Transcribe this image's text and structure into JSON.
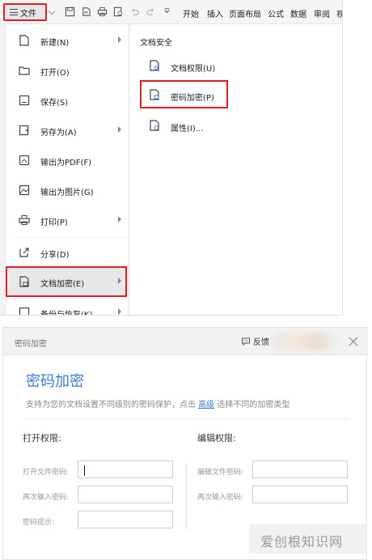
{
  "toolbar": {
    "file_label": "文件",
    "ribbon_tabs": [
      "开始",
      "插入",
      "页面布局",
      "公式",
      "数据",
      "审阅",
      "视"
    ]
  },
  "left_menu": {
    "items": [
      {
        "label": "新建(N)",
        "icon": "new-doc-icon",
        "submenu": true
      },
      {
        "label": "打开(O)",
        "icon": "folder-icon",
        "submenu": false
      },
      {
        "label": "保存(S)",
        "icon": "save-icon",
        "submenu": false
      },
      {
        "label": "另存为(A)",
        "icon": "save-as-icon",
        "submenu": true
      },
      {
        "label": "输出为PDF(F)",
        "icon": "pdf-icon",
        "submenu": false
      },
      {
        "label": "输出为图片(G)",
        "icon": "image-icon",
        "submenu": false
      },
      {
        "label": "打印(P)",
        "icon": "print-icon",
        "submenu": true
      },
      {
        "label": "分享(D)",
        "icon": "share-icon",
        "submenu": false
      },
      {
        "label": "文档加密(E)",
        "icon": "encrypt-doc-icon",
        "submenu": true
      },
      {
        "label": "备份与恢复(K)",
        "icon": "backup-icon",
        "submenu": true
      }
    ]
  },
  "right_pane": {
    "title": "文档安全",
    "items": [
      {
        "label": "文档权限(U)",
        "icon": "doc-permission-icon"
      },
      {
        "label": "密码加密(P)",
        "icon": "doc-lock-icon"
      },
      {
        "label": "属性(I)...",
        "icon": "doc-properties-icon"
      }
    ]
  },
  "dialog": {
    "title": "密码加密",
    "feedback_label": "反馈",
    "heading": "密码加密",
    "desc_prefix": "支持为您的文档设置不同级别的密码保护，点击",
    "desc_link": "高级",
    "desc_suffix": "选择不同的加密类型",
    "open_section": {
      "title": "打开权限:",
      "fields": [
        {
          "label": "打开文件密码:",
          "value": ""
        },
        {
          "label": "再次输入密码:",
          "value": ""
        },
        {
          "label": "密码提示:",
          "value": ""
        }
      ]
    },
    "edit_section": {
      "title": "编辑权限:",
      "fields": [
        {
          "label": "编辑文件密码:",
          "value": ""
        },
        {
          "label": "再次输入密码:",
          "value": ""
        }
      ]
    }
  },
  "watermark": "爱创根知识网",
  "colors": {
    "highlight_red": "#e02020",
    "accent_blue": "#3a7bd5"
  }
}
